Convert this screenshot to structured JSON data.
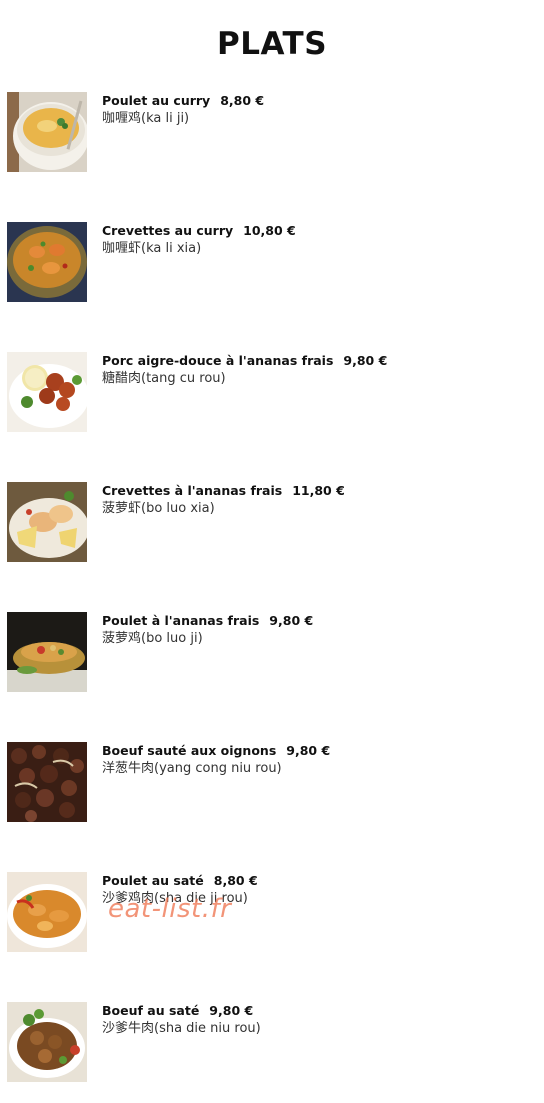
{
  "page": {
    "title": "PLATS"
  },
  "dishes": [
    {
      "name": "Poulet au curry",
      "price": "8,80 €",
      "chinese": "咖喱鸡(ka li ji)"
    },
    {
      "name": "Crevettes au curry",
      "price": "10,80 €",
      "chinese": "咖喱虾(ka li xia)"
    },
    {
      "name": "Porc aigre-douce à l'ananas frais",
      "price": "9,80 €",
      "chinese": "糖醋肉(tang cu rou)"
    },
    {
      "name": "Crevettes à l'ananas frais",
      "price": "11,80 €",
      "chinese": "菠萝虾(bo luo xia)"
    },
    {
      "name": "Poulet à l'ananas frais",
      "price": "9,80 €",
      "chinese": "菠萝鸡(bo luo ji)"
    },
    {
      "name": "Boeuf sauté aux oignons",
      "price": "9,80 €",
      "chinese": "洋葱牛肉(yang cong niu rou)"
    },
    {
      "name": "Poulet au saté",
      "price": "8,80 €",
      "chinese": "沙爹鸡肉(sha die ji rou)"
    },
    {
      "name": "Boeuf au saté",
      "price": "9,80 €",
      "chinese": "沙爹牛肉(sha die niu rou)"
    }
  ],
  "watermark": {
    "text": "eat-list.fr",
    "color": "#ee7652"
  }
}
